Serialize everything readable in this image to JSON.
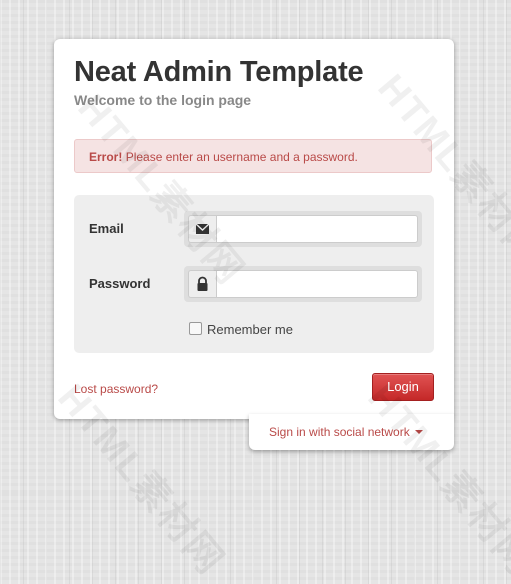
{
  "header": {
    "title": "Neat Admin Template",
    "subtitle": "Welcome to the login page"
  },
  "alert": {
    "strong": "Error!",
    "message": "Please enter an username and a password."
  },
  "form": {
    "email_label": "Email",
    "email_value": "",
    "email_icon": "envelope-icon",
    "password_label": "Password",
    "password_value": "",
    "password_icon": "lock-icon",
    "remember_label": "Remember me",
    "remember_checked": false
  },
  "footer": {
    "lost_password": "Lost password?",
    "login_label": "Login",
    "social_label": "Sign in with social network"
  },
  "colors": {
    "accent": "#c42828",
    "link": "#b94a48",
    "error_bg": "#f5e3e3"
  }
}
